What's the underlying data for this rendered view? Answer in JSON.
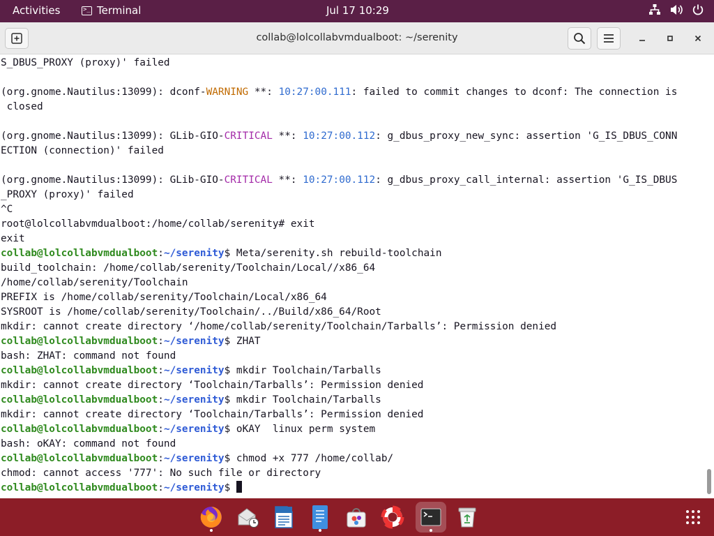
{
  "topbar": {
    "activities": "Activities",
    "app_name": "Terminal",
    "clock": "Jul 17  10:29"
  },
  "window": {
    "title": "collab@lolcollabvmdualboot: ~/serenity"
  },
  "terminal": {
    "prompt_user": "collab@lolcollabvmdualboot",
    "lines": [
      {
        "kind": "plain",
        "text": "S_DBUS_PROXY (proxy)' failed"
      },
      {
        "kind": "plain",
        "text": ""
      },
      {
        "kind": "log",
        "prefix": "(org.gnome.Nautilus:13099): dconf-",
        "level": "WARNING",
        "mid": " **: ",
        "time": "10:27:00.111",
        "msg": ": failed to commit changes to dconf: The connection is",
        "level_class": "warn"
      },
      {
        "kind": "plain",
        "text": " closed"
      },
      {
        "kind": "plain",
        "text": ""
      },
      {
        "kind": "log",
        "prefix": "(org.gnome.Nautilus:13099): GLib-GIO-",
        "level": "CRITICAL",
        "mid": " **: ",
        "time": "10:27:00.112",
        "msg": ": g_dbus_proxy_new_sync: assertion 'G_IS_DBUS_CONN",
        "level_class": "crit"
      },
      {
        "kind": "plain",
        "text": "ECTION (connection)' failed"
      },
      {
        "kind": "plain",
        "text": ""
      },
      {
        "kind": "log",
        "prefix": "(org.gnome.Nautilus:13099): GLib-GIO-",
        "level": "CRITICAL",
        "mid": " **: ",
        "time": "10:27:00.112",
        "msg": ": g_dbus_proxy_call_internal: assertion 'G_IS_DBUS",
        "level_class": "crit"
      },
      {
        "kind": "plain",
        "text": "_PROXY (proxy)' failed"
      },
      {
        "kind": "plain",
        "text": "^C"
      },
      {
        "kind": "plain",
        "text": "root@lolcollabvmdualboot:/home/collab/serenity# exit"
      },
      {
        "kind": "plain",
        "text": "exit"
      },
      {
        "kind": "prompt",
        "dir": "~/serenity",
        "cmd": " Meta/serenity.sh rebuild-toolchain"
      },
      {
        "kind": "plain",
        "text": "build_toolchain: /home/collab/serenity/Toolchain/Local//x86_64"
      },
      {
        "kind": "plain",
        "text": "/home/collab/serenity/Toolchain"
      },
      {
        "kind": "plain",
        "text": "PREFIX is /home/collab/serenity/Toolchain/Local/x86_64"
      },
      {
        "kind": "plain",
        "text": "SYSROOT is /home/collab/serenity/Toolchain/../Build/x86_64/Root"
      },
      {
        "kind": "plain",
        "text": "mkdir: cannot create directory ‘/home/collab/serenity/Toolchain/Tarballs’: Permission denied"
      },
      {
        "kind": "prompt",
        "dir": "~/serenity",
        "cmd": " ZHAT"
      },
      {
        "kind": "plain",
        "text": "bash: ZHAT: command not found"
      },
      {
        "kind": "prompt",
        "dir": "~/serenity",
        "cmd": " mkdir Toolchain/Tarballs"
      },
      {
        "kind": "plain",
        "text": "mkdir: cannot create directory ‘Toolchain/Tarballs’: Permission denied"
      },
      {
        "kind": "prompt",
        "dir": "~/serenity",
        "cmd": " mkdir Toolchain/Tarballs"
      },
      {
        "kind": "plain",
        "text": "mkdir: cannot create directory ‘Toolchain/Tarballs’: Permission denied"
      },
      {
        "kind": "prompt",
        "dir": "~/serenity",
        "cmd": " oKAY  linux perm system"
      },
      {
        "kind": "plain",
        "text": "bash: oKAY: command not found"
      },
      {
        "kind": "prompt",
        "dir": "~/serenity",
        "cmd": " chmod +x 777 /home/collab/"
      },
      {
        "kind": "plain",
        "text": "chmod: cannot access '777': No such file or directory"
      },
      {
        "kind": "prompt",
        "dir": "~/serenity",
        "cmd": " ",
        "cursor": true
      }
    ]
  },
  "dock": {
    "items": [
      {
        "name": "firefox",
        "icon": "firefox-icon",
        "running": true
      },
      {
        "name": "thunderbird",
        "icon": "mail-clock-icon",
        "running": false
      },
      {
        "name": "writer",
        "icon": "document-icon",
        "running": false
      },
      {
        "name": "text-editor",
        "icon": "text-editor-icon",
        "running": true
      },
      {
        "name": "software",
        "icon": "store-bag-icon",
        "running": false
      },
      {
        "name": "help",
        "icon": "lifebuoy-icon",
        "running": false
      },
      {
        "name": "terminal",
        "icon": "terminal-icon",
        "running": true,
        "active": true
      },
      {
        "name": "trash",
        "icon": "trash-icon",
        "running": false
      }
    ],
    "apps_grid_icon": "apps-grid-icon"
  },
  "colors": {
    "topbar": "#5a1f46",
    "dock": "#8c1d27",
    "prompt_user": "#2f8a1e",
    "prompt_dir": "#2f5bd6",
    "warning": "#c06a00",
    "critical": "#a32aa8",
    "timestamp": "#2f6bcf"
  }
}
